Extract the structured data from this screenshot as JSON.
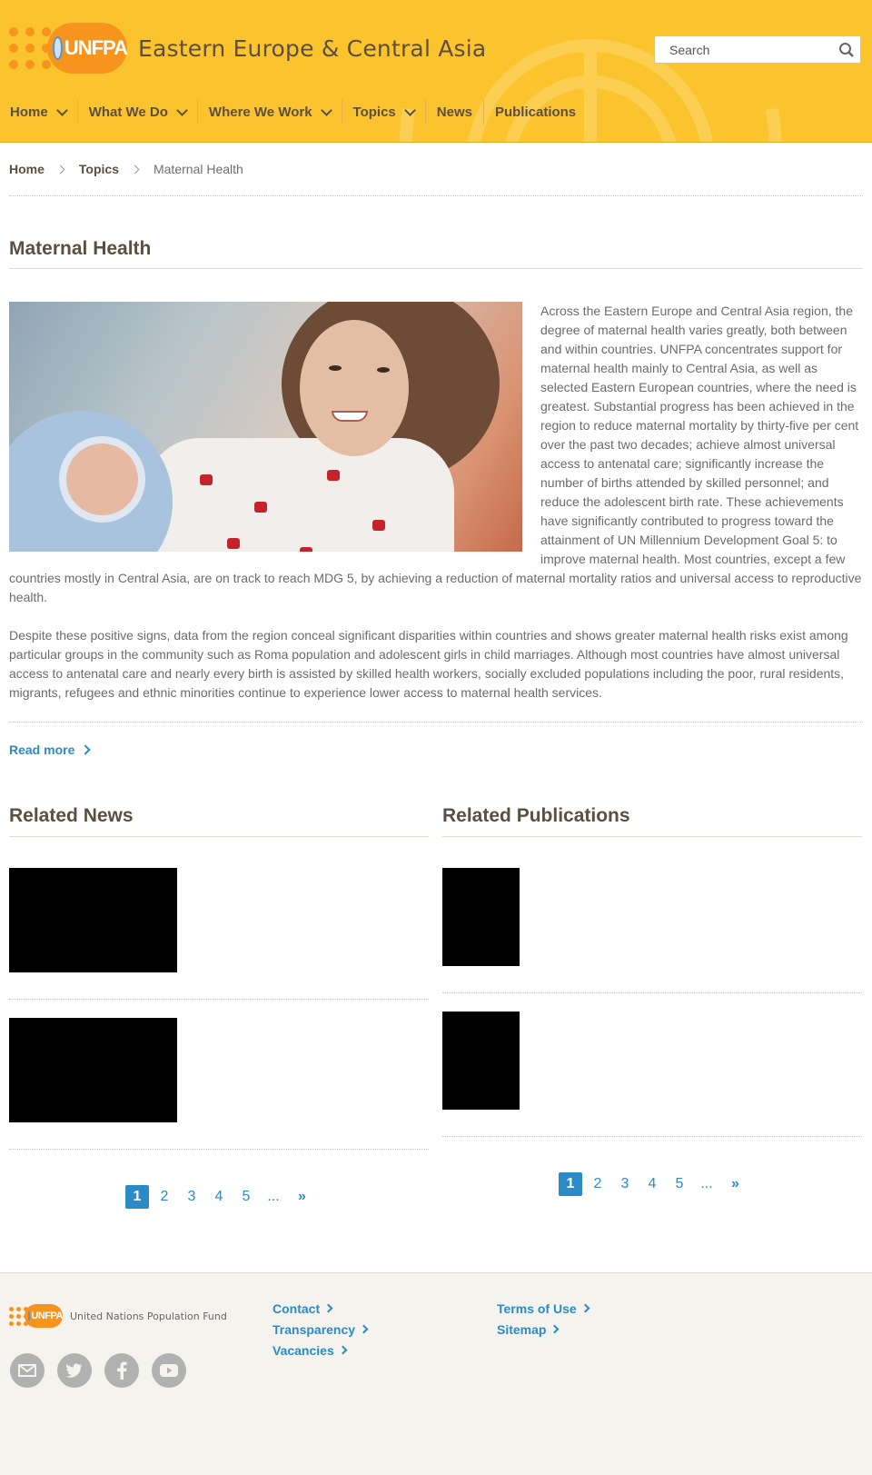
{
  "header": {
    "logo_text": "UNFPA",
    "site_title": "Eastern Europe & Central Asia",
    "search_placeholder": "Search",
    "nav": [
      {
        "label": "Home",
        "has_dropdown": true
      },
      {
        "label": "What We Do",
        "has_dropdown": true
      },
      {
        "label": "Where We Work",
        "has_dropdown": true
      },
      {
        "label": "Topics",
        "has_dropdown": true
      },
      {
        "label": "News",
        "has_dropdown": false
      },
      {
        "label": "Publications",
        "has_dropdown": false
      }
    ]
  },
  "breadcrumb": {
    "home": "Home",
    "topics": "Topics",
    "current": "Maternal Health"
  },
  "main": {
    "title": "Maternal Health",
    "paragraph1": "Across the Eastern Europe and Central Asia region, the degree of maternal health varies greatly, both between and within countries. UNFPA concentrates support for maternal health mainly to Central Asia, as well as selected Eastern European countries, where the need is greatest. Substantial progress has been achieved in the region to reduce maternal mortality by thirty-five per cent over the past two decades; achieve almost universal access to antenatal care; significantly increase the number of births attended by skilled personnel; and reduce the adolescent birth rate. These achievements have significantly contributed to progress toward the attainment of UN Millennium Development Goal 5: to improve maternal health. Most countries, except a few countries mostly in Central Asia, are on track to reach MDG 5, by achieving a reduction of maternal mortality ratios and universal access to reproductive health.",
    "paragraph2": "Despite these positive signs, data from the region conceal significant disparities within countries and shows greater maternal health risks exist among particular groups in the community such as Roma population and adolescent girls in child marriages. Although most countries have almost universal access to antenatal care and nearly every birth is assisted by skilled health workers, socially excluded populations including the poor, rural residents, migrants, refugees and ethnic minorities continue to experience lower access to maternal health services.",
    "read_more": "Read more"
  },
  "related_news": {
    "title": "Related News",
    "pager": {
      "pages": [
        "1",
        "2",
        "3",
        "4",
        "5"
      ],
      "ellipsis": "...",
      "next": "»",
      "active": "1"
    }
  },
  "related_publications": {
    "title": "Related Publications",
    "pager": {
      "pages": [
        "1",
        "2",
        "3",
        "4",
        "5"
      ],
      "ellipsis": "...",
      "next": "»",
      "active": "1"
    }
  },
  "footer": {
    "logo_text": "UNFPA",
    "org_name": "United Nations Population Fund",
    "links_col1": [
      "Contact",
      "Transparency",
      "Vacancies"
    ],
    "links_col2": [
      "Terms of Use",
      "Sitemap"
    ],
    "social": [
      "email-icon",
      "twitter-icon",
      "facebook-icon",
      "youtube-icon"
    ]
  },
  "colors": {
    "header_bg": "#fbc42f",
    "brand_orange": "#f7941d",
    "link_blue": "#2a8bc7",
    "heading_brown": "#5d4f3f"
  }
}
